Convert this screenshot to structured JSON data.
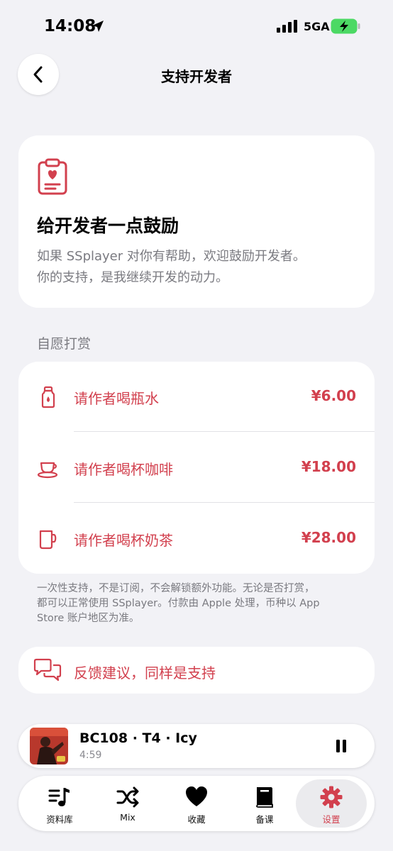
{
  "status_bar": {
    "time": "14:08",
    "network": "5GA",
    "icons": [
      "location-arrow-icon",
      "signal-bars-icon",
      "battery-charging-icon"
    ]
  },
  "nav": {
    "title": "支持开发者",
    "back_icon": "chevron-left-icon"
  },
  "hero": {
    "icon": "clipboard-heart-icon",
    "heading": "给开发者一点鼓励",
    "desc_line1": "如果 SSplayer 对你有帮助，欢迎鼓励开发者。",
    "desc_line2": "你的支持，是我继续开发的动力。"
  },
  "tips": {
    "section_label": "自愿打赏",
    "items": [
      {
        "icon": "water-bottle-icon",
        "label": "请作者喝瓶水",
        "price": "¥6.00"
      },
      {
        "icon": "coffee-cup-icon",
        "label": "请作者喝杯咖啡",
        "price": "¥18.00"
      },
      {
        "icon": "mug-icon",
        "label": "请作者喝杯奶茶",
        "price": "¥28.00"
      }
    ],
    "footnote_line1": "一次性支持，不是订阅，不会解锁额外功能。无论是否打赏，",
    "footnote_line2": "都可以正常使用 SSplayer。付款由 Apple 处理，币种以 App",
    "footnote_line3": "Store 账户地区为准。"
  },
  "feedback": {
    "icon": "chat-bubbles-icon",
    "label": "反馈建议，同样是支持"
  },
  "player": {
    "title": "BC108 · T4 · Icy",
    "time": "4:59",
    "icon": "pause-icon"
  },
  "tabs": [
    {
      "label": "资料库",
      "icon": "music-library-icon",
      "active": false
    },
    {
      "label": "Mix",
      "icon": "shuffle-icon",
      "active": false
    },
    {
      "label": "收藏",
      "icon": "heart-icon",
      "active": false
    },
    {
      "label": "备课",
      "icon": "book-icon",
      "active": false
    },
    {
      "label": "设置",
      "icon": "gear-icon",
      "active": true
    }
  ],
  "colors": {
    "accent": "#d2404e",
    "background": "#f2f2f6",
    "card": "#ffffff",
    "secondary_text": "#7a7a80",
    "battery_green": "#4cd964"
  }
}
